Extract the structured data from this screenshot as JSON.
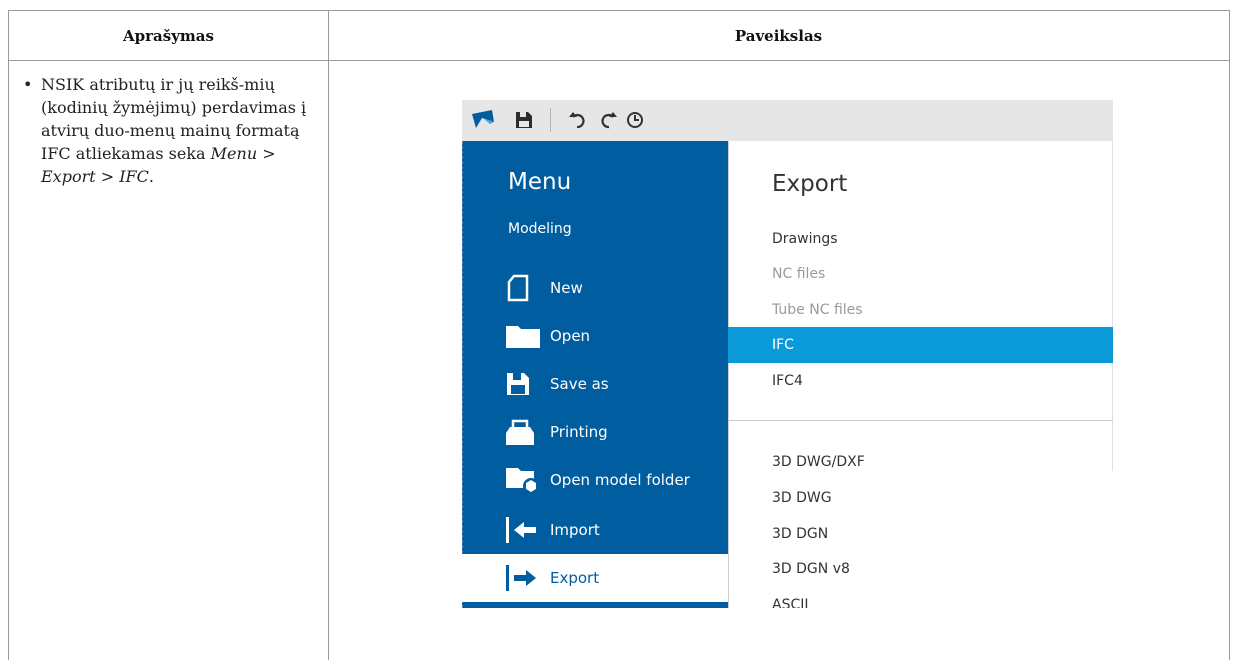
{
  "table": {
    "col1_header": "Aprašymas",
    "col2_header": "Paveikslas"
  },
  "description": {
    "bullet": "•",
    "text_lead": "NSIK atributų ir jų reikš-mių (kodinių žymėjimų) perdavimas į atvirų duo-menų mainų formatą IFC atliekamas seka ",
    "path": "Menu > Export > IFC",
    "text_end": "."
  },
  "screenshot": {
    "toolbar": {
      "icons": [
        "app-logo-icon",
        "save-icon",
        "undo-icon",
        "redo-icon",
        "history-icon"
      ]
    },
    "menu": {
      "title": "Menu",
      "subtitle": "Modeling",
      "items": [
        {
          "label": "New",
          "icon": "new-file-icon"
        },
        {
          "label": "Open",
          "icon": "folder-icon"
        },
        {
          "label": "Save as",
          "icon": "save-icon"
        },
        {
          "label": "Printing",
          "icon": "print-icon"
        },
        {
          "label": "Open model folder",
          "icon": "model-folder-icon"
        },
        {
          "label": "Import",
          "icon": "import-icon"
        },
        {
          "label": "Export",
          "icon": "export-icon",
          "active": true
        }
      ]
    },
    "export": {
      "title": "Export",
      "items": [
        {
          "label": "Drawings",
          "state": "enabled"
        },
        {
          "label": "NC files",
          "state": "disabled"
        },
        {
          "label": "Tube NC files",
          "state": "disabled"
        },
        {
          "label": "IFC",
          "state": "selected"
        },
        {
          "label": "IFC4",
          "state": "enabled"
        },
        {
          "label": "3D DWG/DXF",
          "state": "enabled"
        },
        {
          "label": "3D DWG",
          "state": "enabled"
        },
        {
          "label": "3D DGN",
          "state": "enabled"
        },
        {
          "label": "3D DGN v8",
          "state": "enabled"
        },
        {
          "label": "ASCII",
          "state": "enabled"
        }
      ]
    },
    "colors": {
      "menu_bg": "#005d9f",
      "selected_bg": "#0a9ad8",
      "toolbar_bg": "#e6e6e6"
    }
  }
}
